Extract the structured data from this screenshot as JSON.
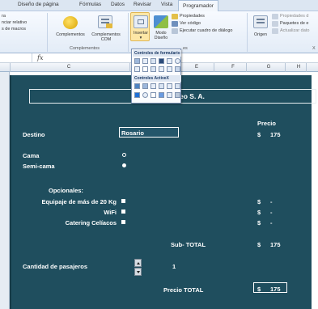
{
  "ribbon": {
    "tabs": [
      "Diseño de página",
      "Fórmulas",
      "Datos",
      "Revisar",
      "Vista",
      "Programador"
    ],
    "active_tab": "Programador",
    "code_group": {
      "items": [
        "ra",
        "nciar relativo",
        "s de macros"
      ]
    },
    "complements_group": {
      "btn1": "Complementos",
      "btn2_line1": "Complementos",
      "btn2_line2": "COM",
      "label": "Complementos"
    },
    "controls_group": {
      "insert_line1": "Insertar",
      "insert_line2": "▾",
      "mode_line1": "Modo",
      "mode_line2": "Diseño",
      "properties": "Propiedades",
      "view_code": "Ver código",
      "run_dialog": "Ejecutar cuadro de diálogo",
      "label": "es"
    },
    "xml_group": {
      "origin": "Origen",
      "props": "Propiedades d",
      "packages": "Paquetes de e",
      "refresh": "Actualizar dato",
      "label": "X"
    }
  },
  "formula_bar": {
    "fx": "fx",
    "name_box": ""
  },
  "columns": [
    "C",
    "E",
    "F",
    "G",
    "H"
  ],
  "dropdown": {
    "form_header": "Controles de formulario",
    "activex_header": "Controles ActiveX"
  },
  "sheet": {
    "title": "Pasajes Aéreo S. A.",
    "precio_header": "Precio",
    "destino_label": "Destino",
    "destino_value": "Rosario",
    "destino_currency": "$",
    "destino_price": "175",
    "cama_label": "Cama",
    "semicama_label": "Semi-cama",
    "opcionales_label": "Opcionales:",
    "equipaje_label": "Equipaje de más de 20 Kg",
    "wifi_label": "WiFi",
    "catering_label": "Catering Celíacos",
    "opt_currency": "$",
    "opt_value": "-",
    "subtotal_label": "Sub- TOTAL",
    "subtotal_currency": "$",
    "subtotal_value": "175",
    "pasajeros_label": "Cantidad de pasajeros",
    "pasajeros_value": "1",
    "total_label": "Precio TOTAL",
    "total_currency": "$",
    "total_value": "175"
  }
}
